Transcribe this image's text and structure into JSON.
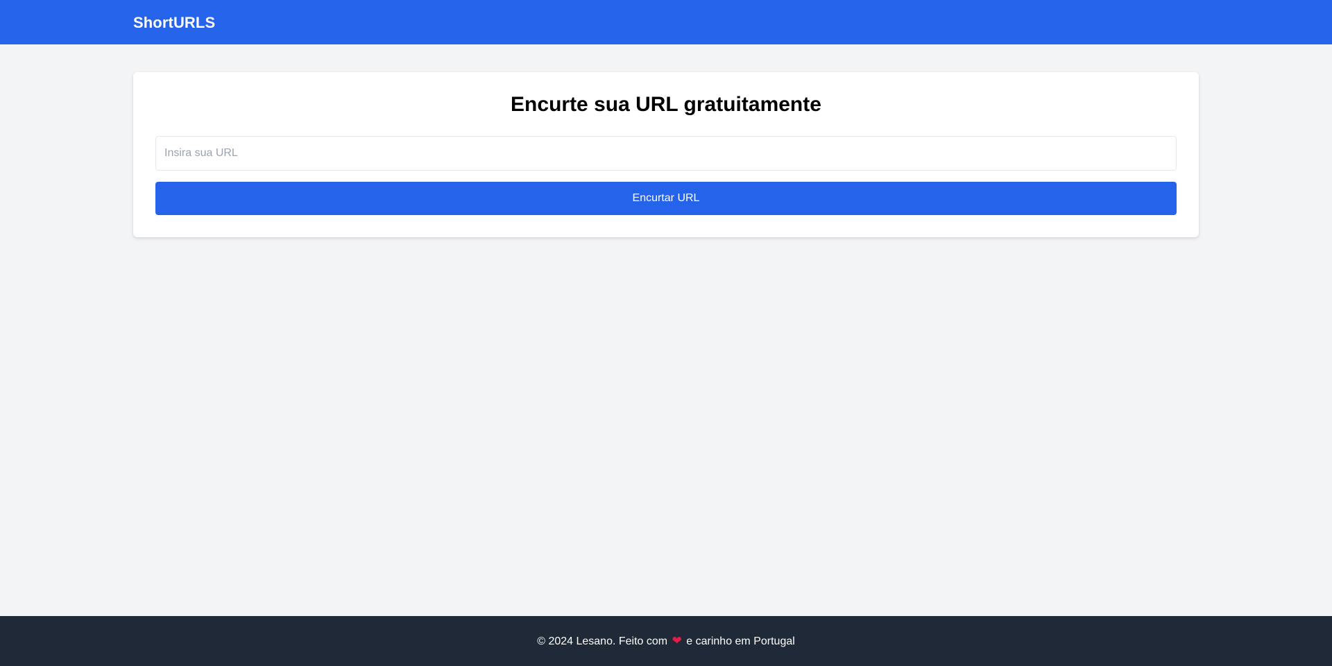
{
  "header": {
    "brand": "ShortURLS"
  },
  "main": {
    "title": "Encurte sua URL gratuitamente",
    "input": {
      "placeholder": "Insira sua URL",
      "value": ""
    },
    "button_label": "Encurtar URL"
  },
  "footer": {
    "text_before": "© 2024 Lesano. Feito com",
    "heart_icon": "❤",
    "text_after": "e carinho em Portugal"
  },
  "colors": {
    "primary": "#2563eb",
    "background": "#f3f4f6",
    "footer": "#1f2937",
    "heart": "#e11d48"
  }
}
